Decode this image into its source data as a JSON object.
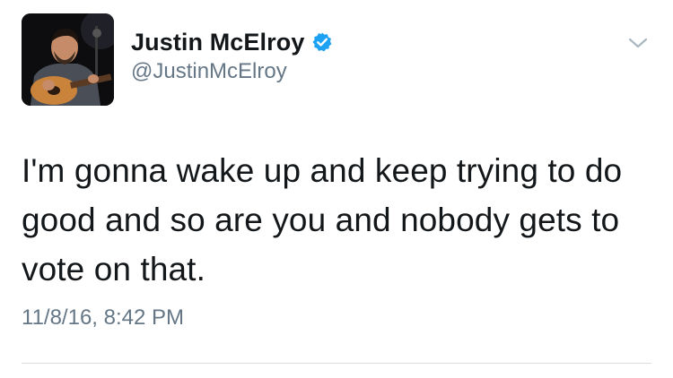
{
  "user": {
    "display_name": "Justin McElroy",
    "handle": "@JustinMcElroy",
    "verified": true,
    "avatar_icon": "profile-photo-musician-with-guitar"
  },
  "tweet": {
    "text": "I'm gonna wake up and keep trying to do good and so are you and nobody gets to vote on that.",
    "timestamp": "11/8/16, 8:42 PM"
  },
  "icons": {
    "verified": "verified-badge-icon",
    "menu": "chevron-down-icon"
  },
  "colors": {
    "verified_blue": "#1da1f2",
    "secondary_text": "#657786",
    "primary_text": "#14171a",
    "divider": "#d9dde1"
  }
}
